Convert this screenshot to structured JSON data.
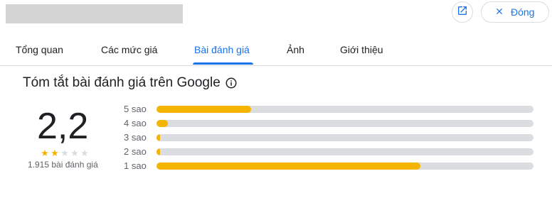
{
  "header": {
    "close_label": "Đóng",
    "open_icon": "open-in-new-icon",
    "close_icon": "close-icon"
  },
  "tabs": [
    {
      "label": "Tổng quan",
      "active": false
    },
    {
      "label": "Các mức giá",
      "active": false
    },
    {
      "label": "Bài đánh giá",
      "active": true
    },
    {
      "label": "Ảnh",
      "active": false
    },
    {
      "label": "Giới thiệu",
      "active": false
    }
  ],
  "summary": {
    "title": "Tóm tắt bài đánh giá trên Google",
    "rating": "2,2",
    "stars_filled": 2,
    "stars_total": 5,
    "review_count": "1.915 bài đánh giá",
    "distribution": [
      {
        "label": "5 sao",
        "fraction": 0.25
      },
      {
        "label": "4 sao",
        "fraction": 0.03
      },
      {
        "label": "3 sao",
        "fraction": 0.01
      },
      {
        "label": "2 sao",
        "fraction": 0.01
      },
      {
        "label": "1 sao",
        "fraction": 0.7
      }
    ]
  },
  "colors": {
    "accent": "#1a73e8",
    "bar_fill": "#f4b400",
    "bar_track": "#dadce0"
  }
}
